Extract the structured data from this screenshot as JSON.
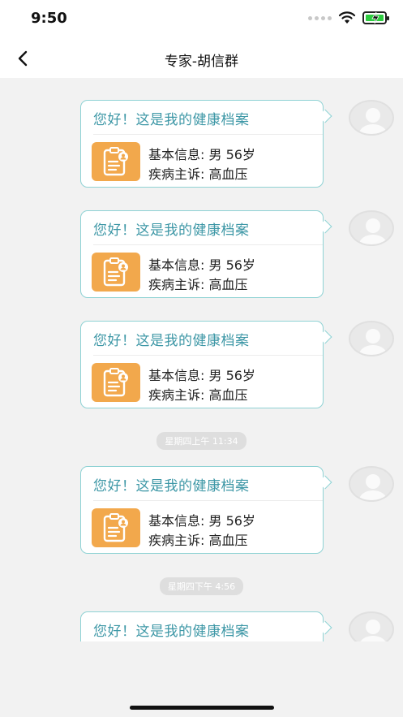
{
  "status_bar": {
    "time": "9:50"
  },
  "nav": {
    "title": "专家-胡信群"
  },
  "message_card": {
    "title": "您好！这是我的健康档案",
    "basic_info": "基本信息: 男 56岁",
    "complaint": "疾病主诉:  高血压"
  },
  "timestamps": [
    "星期四上午 11:34",
    "星期四下午 4:56"
  ],
  "colors": {
    "bubble_border": "#8fd2d4",
    "title_text": "#3d97a6",
    "doc_icon_bg": "#f2a84c",
    "background": "#f2f2f2"
  },
  "icons": {
    "back": "chevron-left-icon",
    "doc": "clipboard-profile-icon",
    "avatar": "default-user-avatar"
  }
}
